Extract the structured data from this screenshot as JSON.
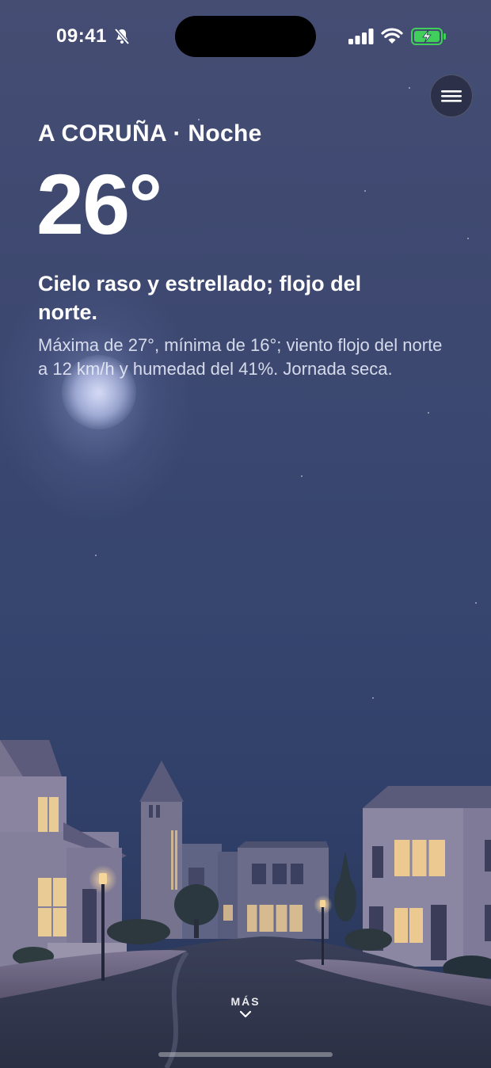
{
  "status_bar": {
    "time": "09:41",
    "silent_icon": "bell-slash-icon",
    "signal_icon": "cellular-signal-icon",
    "wifi_icon": "wifi-icon",
    "battery_icon": "battery-charging-icon",
    "battery_color": "#3fcf5a"
  },
  "header": {
    "location": "A CORUÑA · Noche",
    "menu_icon": "hamburger-menu-icon"
  },
  "weather": {
    "temperature": "26°",
    "summary": "Cielo raso y estrellado; flojo del norte.",
    "details": "Máxima de 27°, mínima de 16°; viento flojo del norte a 12 km/h y humedad del 41%. Jornada seca."
  },
  "footer": {
    "more_label": "MÁS",
    "more_icon": "chevron-down-icon"
  }
}
